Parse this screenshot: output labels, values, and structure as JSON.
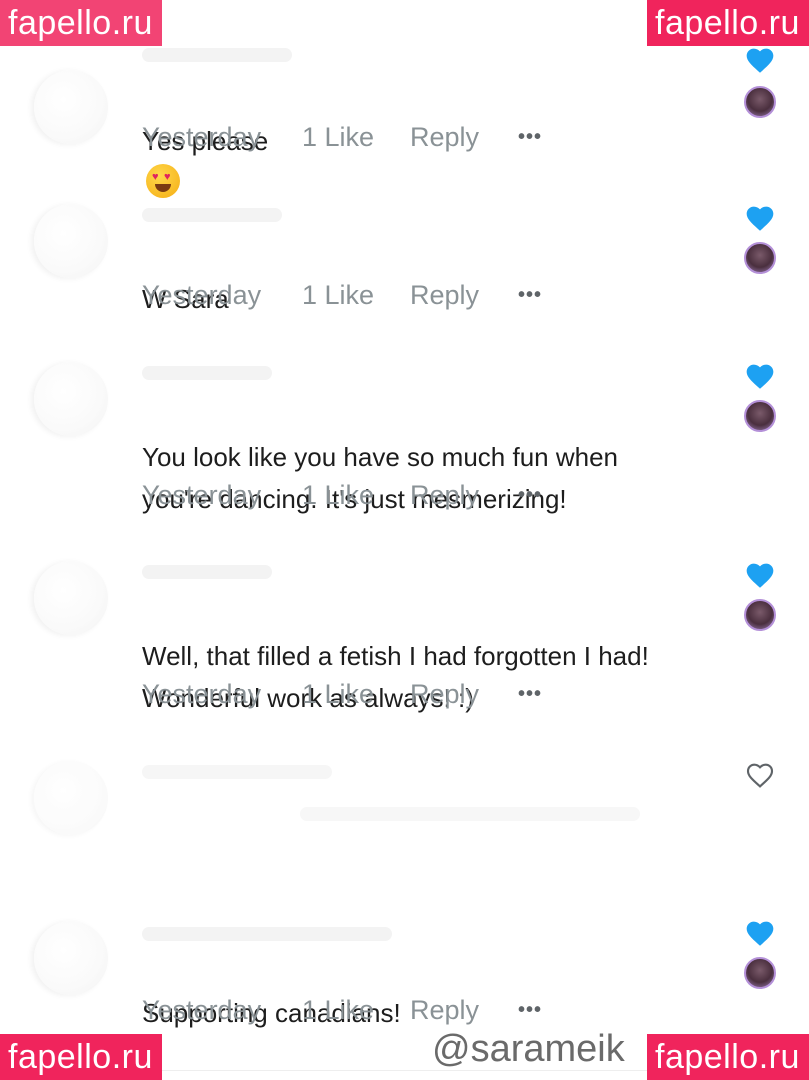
{
  "watermarks": {
    "top_left": "fapello.ru",
    "top_right": "fapello.ru",
    "bottom_left": "fapello.ru",
    "bottom_right": "fapello.ru"
  },
  "comments": [
    {
      "text": "Yes please",
      "emoji": "heart-eyes-emoji",
      "time": "Yesterday",
      "likes": "1 Like",
      "reply": "Reply",
      "more": "•••",
      "liked_by_creator": true
    },
    {
      "text": "W Sara",
      "time": "Yesterday",
      "likes": "1 Like",
      "reply": "Reply",
      "more": "•••",
      "liked_by_creator": true
    },
    {
      "text": "You look like you have so much fun when\nyou're dancing. It's just mesmerizing!",
      "time": "Yesterday",
      "likes": "1 Like",
      "reply": "Reply",
      "more": "•••",
      "liked_by_creator": true
    },
    {
      "text": "Well, that filled a fetish I had forgotten I had!\nWonderful work as always! :)",
      "time": "Yesterday",
      "likes": "1 Like",
      "reply": "Reply",
      "more": "•••",
      "liked_by_creator": true
    },
    {
      "text": "Supporting canadians!",
      "time": "Yesterday",
      "likes": "1 Like",
      "reply": "Reply",
      "more": "•••",
      "liked_by_creator": true
    }
  ],
  "handle": "@sarameik",
  "colors": {
    "like_blue": "#1da1f2",
    "meta_gray": "#8a9296",
    "watermark": "#f0245c"
  }
}
